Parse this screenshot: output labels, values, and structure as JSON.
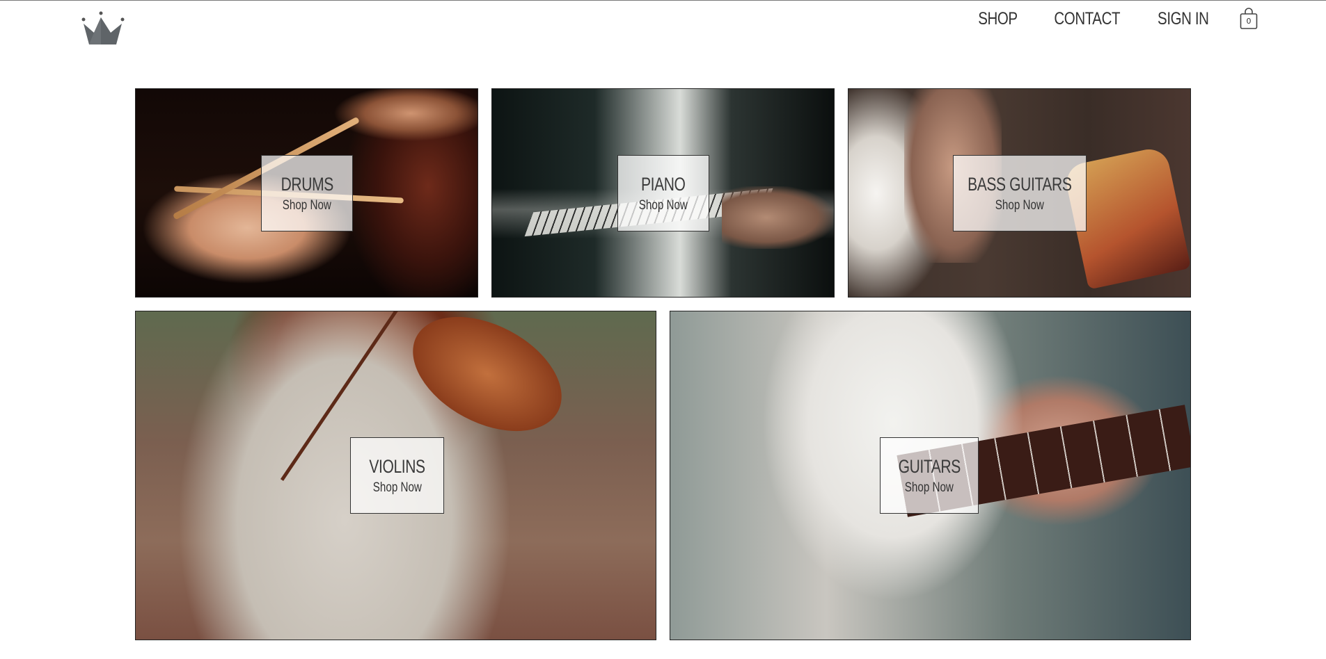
{
  "header": {
    "logo_icon": "crown-icon",
    "nav": [
      {
        "label": "SHOP"
      },
      {
        "label": "CONTACT"
      },
      {
        "label": "SIGN IN"
      }
    ],
    "cart": {
      "icon": "shopping-bag-icon",
      "count": "0"
    }
  },
  "categories": [
    {
      "title": "DRUMS",
      "cta": "Shop Now"
    },
    {
      "title": "PIANO",
      "cta": "Shop Now"
    },
    {
      "title": "BASS GUITARS",
      "cta": "Shop Now"
    },
    {
      "title": "VIOLINS",
      "cta": "Shop Now"
    },
    {
      "title": "GUITARS",
      "cta": "Shop Now"
    }
  ]
}
